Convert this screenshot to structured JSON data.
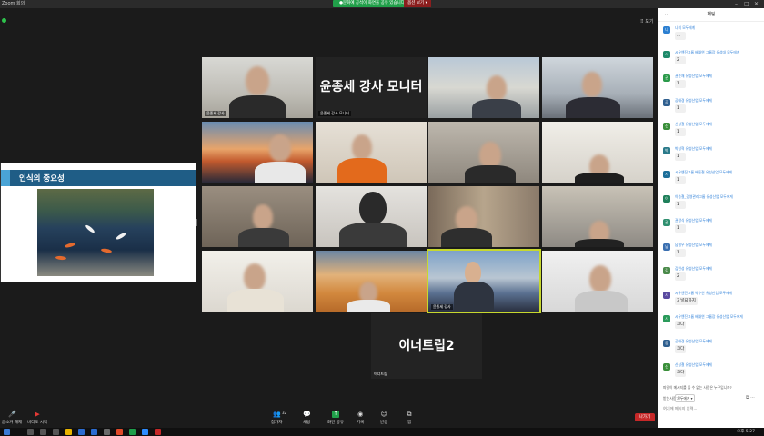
{
  "window": {
    "app_title": "Zoom 회의",
    "share_banner": "●문화예 공석이 화면을 공유 있습니다",
    "share_stop": "옵션 보기 ▾",
    "view_label": "⠿ 보기"
  },
  "slide": {
    "title": "인식의 중요성"
  },
  "tiles": [
    {
      "name": "윤종세 강사",
      "big_text": ""
    },
    {
      "name": "윤종세 강사 모니터",
      "big_text": "윤종세 강사 모니터"
    },
    {
      "name": "",
      "big_text": ""
    },
    {
      "name": "",
      "big_text": ""
    },
    {
      "name": "",
      "big_text": ""
    },
    {
      "name": "",
      "big_text": ""
    },
    {
      "name": "",
      "big_text": ""
    },
    {
      "name": "",
      "big_text": ""
    },
    {
      "name": "",
      "big_text": ""
    },
    {
      "name": "",
      "big_text": ""
    },
    {
      "name": "",
      "big_text": ""
    },
    {
      "name": "",
      "big_text": ""
    },
    {
      "name": "",
      "big_text": ""
    },
    {
      "name": "",
      "big_text": ""
    },
    {
      "name": "윤종세 강사",
      "big_text": ""
    },
    {
      "name": "",
      "big_text": ""
    }
  ],
  "big_tile": {
    "text": "이너트립2",
    "name": "이너트립"
  },
  "toolbar": {
    "left": [
      {
        "label": "음소거 해제",
        "icon": "microphone-muted-icon"
      },
      {
        "label": "비디오 시작",
        "icon": "video-off-icon"
      }
    ],
    "center": [
      {
        "label": "참가자",
        "icon": "participants-icon",
        "count": "32"
      },
      {
        "label": "채팅",
        "icon": "chat-icon"
      },
      {
        "label": "화면 공유",
        "icon": "share-screen-icon"
      },
      {
        "label": "기록",
        "icon": "record-icon"
      },
      {
        "label": "반응",
        "icon": "reactions-icon"
      },
      {
        "label": "앱",
        "icon": "apps-icon"
      }
    ],
    "end_label": "나가기"
  },
  "chat": {
    "header": "채팅",
    "messages": [
      {
        "who": "나의 모두에게",
        "text": "...",
        "color": "#2b7fd1"
      },
      {
        "who": "시우엔진그룹 배재연 그룹장 유성대 모두에게",
        "text": "2",
        "color": "#1e8a6a"
      },
      {
        "who": "권순재 유성산업 모두에게",
        "text": "1",
        "color": "#2b9a4a"
      },
      {
        "who": "공태경 유성산업 모두에게",
        "text": "1",
        "color": "#2f5f8f"
      },
      {
        "who": "신성철 유성산업 모두에게",
        "text": "1",
        "color": "#3a8f3a"
      },
      {
        "who": "박성혁 유성산업 모두에게",
        "text": "1",
        "color": "#2a7a8a"
      },
      {
        "who": "시우엔진그룹 배동철 유성산업 모두에게",
        "text": "1",
        "color": "#1d6f9a"
      },
      {
        "who": "이승철_경영관리그룹 유성산업 모두에게",
        "text": "1",
        "color": "#1e7f5a"
      },
      {
        "who": "권광식 유성산업 모두에게",
        "text": "1",
        "color": "#2f8f6f"
      },
      {
        "who": "남필우 유성산업 모두에게",
        "text": "1",
        "color": "#3a6fb0"
      },
      {
        "who": "김민성 유성산업 모두에게",
        "text": "2",
        "color": "#4a8a4a"
      },
      {
        "who": "시우엔진그룹 박수연 유성산업 모두에게",
        "text": "3 넣되하지",
        "color": "#5a4aa0"
      },
      {
        "who": "시우엔진그룹 배재연 그룹장 유성산업 모두에게",
        "text": "크다",
        "color": "#2a9a5a"
      },
      {
        "who": "공태경 유성산업 모두에게",
        "text": "크다",
        "color": "#2f5f8f"
      },
      {
        "who": "신성철 유성산업 모두에게",
        "text": "크다",
        "color": "#3a8f3a"
      }
    ],
    "tip": "파일이 메시지를 올 수 없는 사람은 누구입니까?",
    "to_label": "받는사람:",
    "to_value": "모두에게 ▾",
    "input_placeholder": "여기에 메시지 입력..."
  },
  "taskbar": {
    "clock": "오후 5:27"
  }
}
